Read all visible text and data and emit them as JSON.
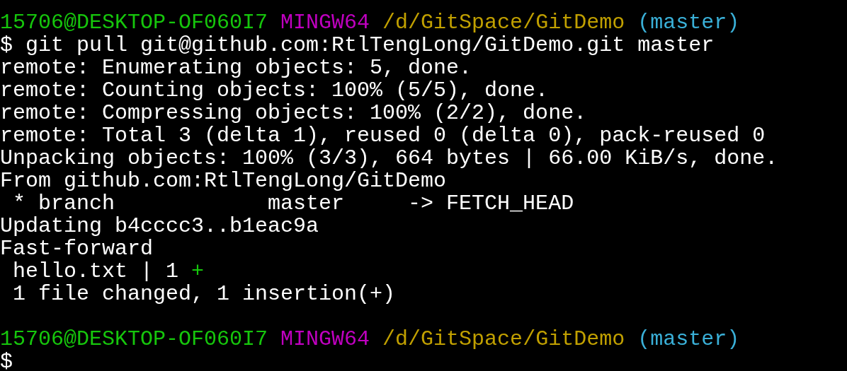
{
  "terminal": {
    "lines": [
      {
        "kind": "prompt",
        "user": "15706@DESKTOP-OF060I7",
        "shell": "MINGW64",
        "path": "/d/GitSpace/GitDemo",
        "branch": "(master)"
      },
      {
        "kind": "text",
        "segments": [
          {
            "text": "$ git pull git@github.com:RtlTengLong/GitDemo.git master",
            "color": "#ffffff"
          }
        ]
      },
      {
        "kind": "text",
        "segments": [
          {
            "text": "remote: Enumerating objects: 5, done.",
            "color": "#ffffff"
          }
        ]
      },
      {
        "kind": "text",
        "segments": [
          {
            "text": "remote: Counting objects: 100% (5/5), done.",
            "color": "#ffffff"
          }
        ]
      },
      {
        "kind": "text",
        "segments": [
          {
            "text": "remote: Compressing objects: 100% (2/2), done.",
            "color": "#ffffff"
          }
        ]
      },
      {
        "kind": "text",
        "segments": [
          {
            "text": "remote: Total 3 (delta 1), reused 0 (delta 0), pack-reused 0",
            "color": "#ffffff"
          }
        ]
      },
      {
        "kind": "text",
        "segments": [
          {
            "text": "Unpacking objects: 100% (3/3), 664 bytes | 66.00 KiB/s, done.",
            "color": "#ffffff"
          }
        ]
      },
      {
        "kind": "text",
        "segments": [
          {
            "text": "From github.com:RtlTengLong/GitDemo",
            "color": "#ffffff"
          }
        ]
      },
      {
        "kind": "text",
        "segments": [
          {
            "text": " * branch            master     -> FETCH_HEAD",
            "color": "#ffffff"
          }
        ]
      },
      {
        "kind": "text",
        "segments": [
          {
            "text": "Updating b4cccc3..b1eac9a",
            "color": "#ffffff"
          }
        ]
      },
      {
        "kind": "text",
        "segments": [
          {
            "text": "Fast-forward",
            "color": "#ffffff"
          }
        ]
      },
      {
        "kind": "text",
        "segments": [
          {
            "text": " hello.txt | 1 ",
            "color": "#ffffff"
          },
          {
            "text": "+",
            "color": "#16c60c"
          }
        ]
      },
      {
        "kind": "text",
        "segments": [
          {
            "text": " 1 file changed, 1 insertion(+)",
            "color": "#ffffff"
          }
        ]
      },
      {
        "kind": "blank"
      },
      {
        "kind": "prompt",
        "user": "15706@DESKTOP-OF060I7",
        "shell": "MINGW64",
        "path": "/d/GitSpace/GitDemo",
        "branch": "(master)"
      },
      {
        "kind": "text",
        "segments": [
          {
            "text": "$",
            "color": "#ffffff"
          }
        ]
      }
    ]
  }
}
